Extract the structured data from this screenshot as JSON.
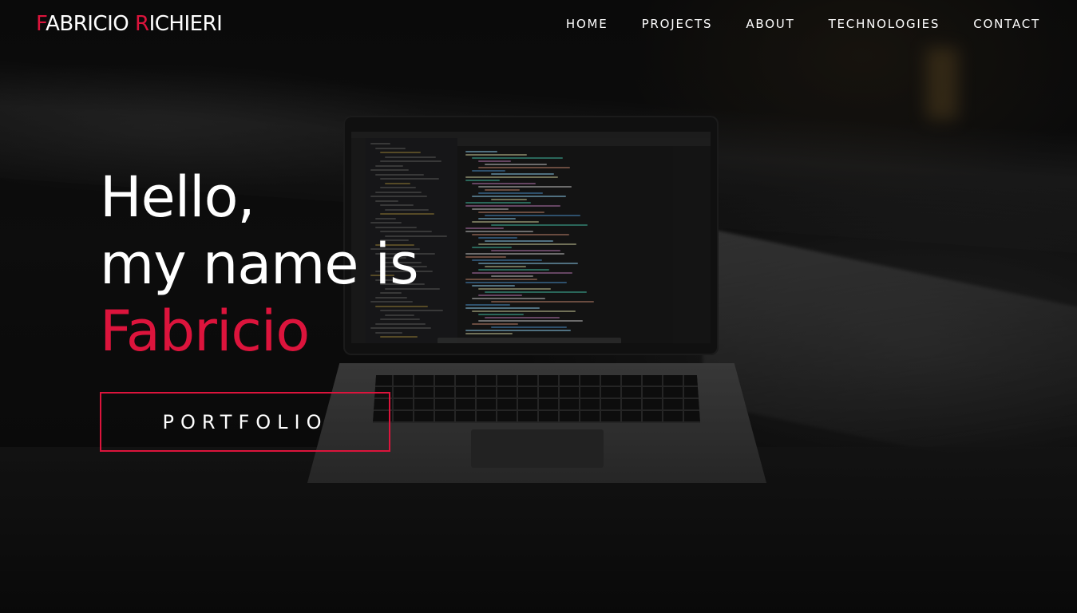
{
  "brand": {
    "first_initial": "F",
    "first_rest": "ABRICIO ",
    "last_initial": "R",
    "last_rest": "ICHIERI"
  },
  "nav": {
    "items": [
      {
        "label": "HOME"
      },
      {
        "label": "PROJECTS"
      },
      {
        "label": "ABOUT"
      },
      {
        "label": "TECHNOLOGIES"
      },
      {
        "label": "CONTACT"
      }
    ]
  },
  "hero": {
    "line1": "Hello,",
    "line2": "my name is",
    "name": "Fabricio",
    "button_label": "PORTFOLIO"
  },
  "colors": {
    "accent": "#dc143c",
    "text": "#ffffff",
    "background": "#0c0c0c"
  }
}
